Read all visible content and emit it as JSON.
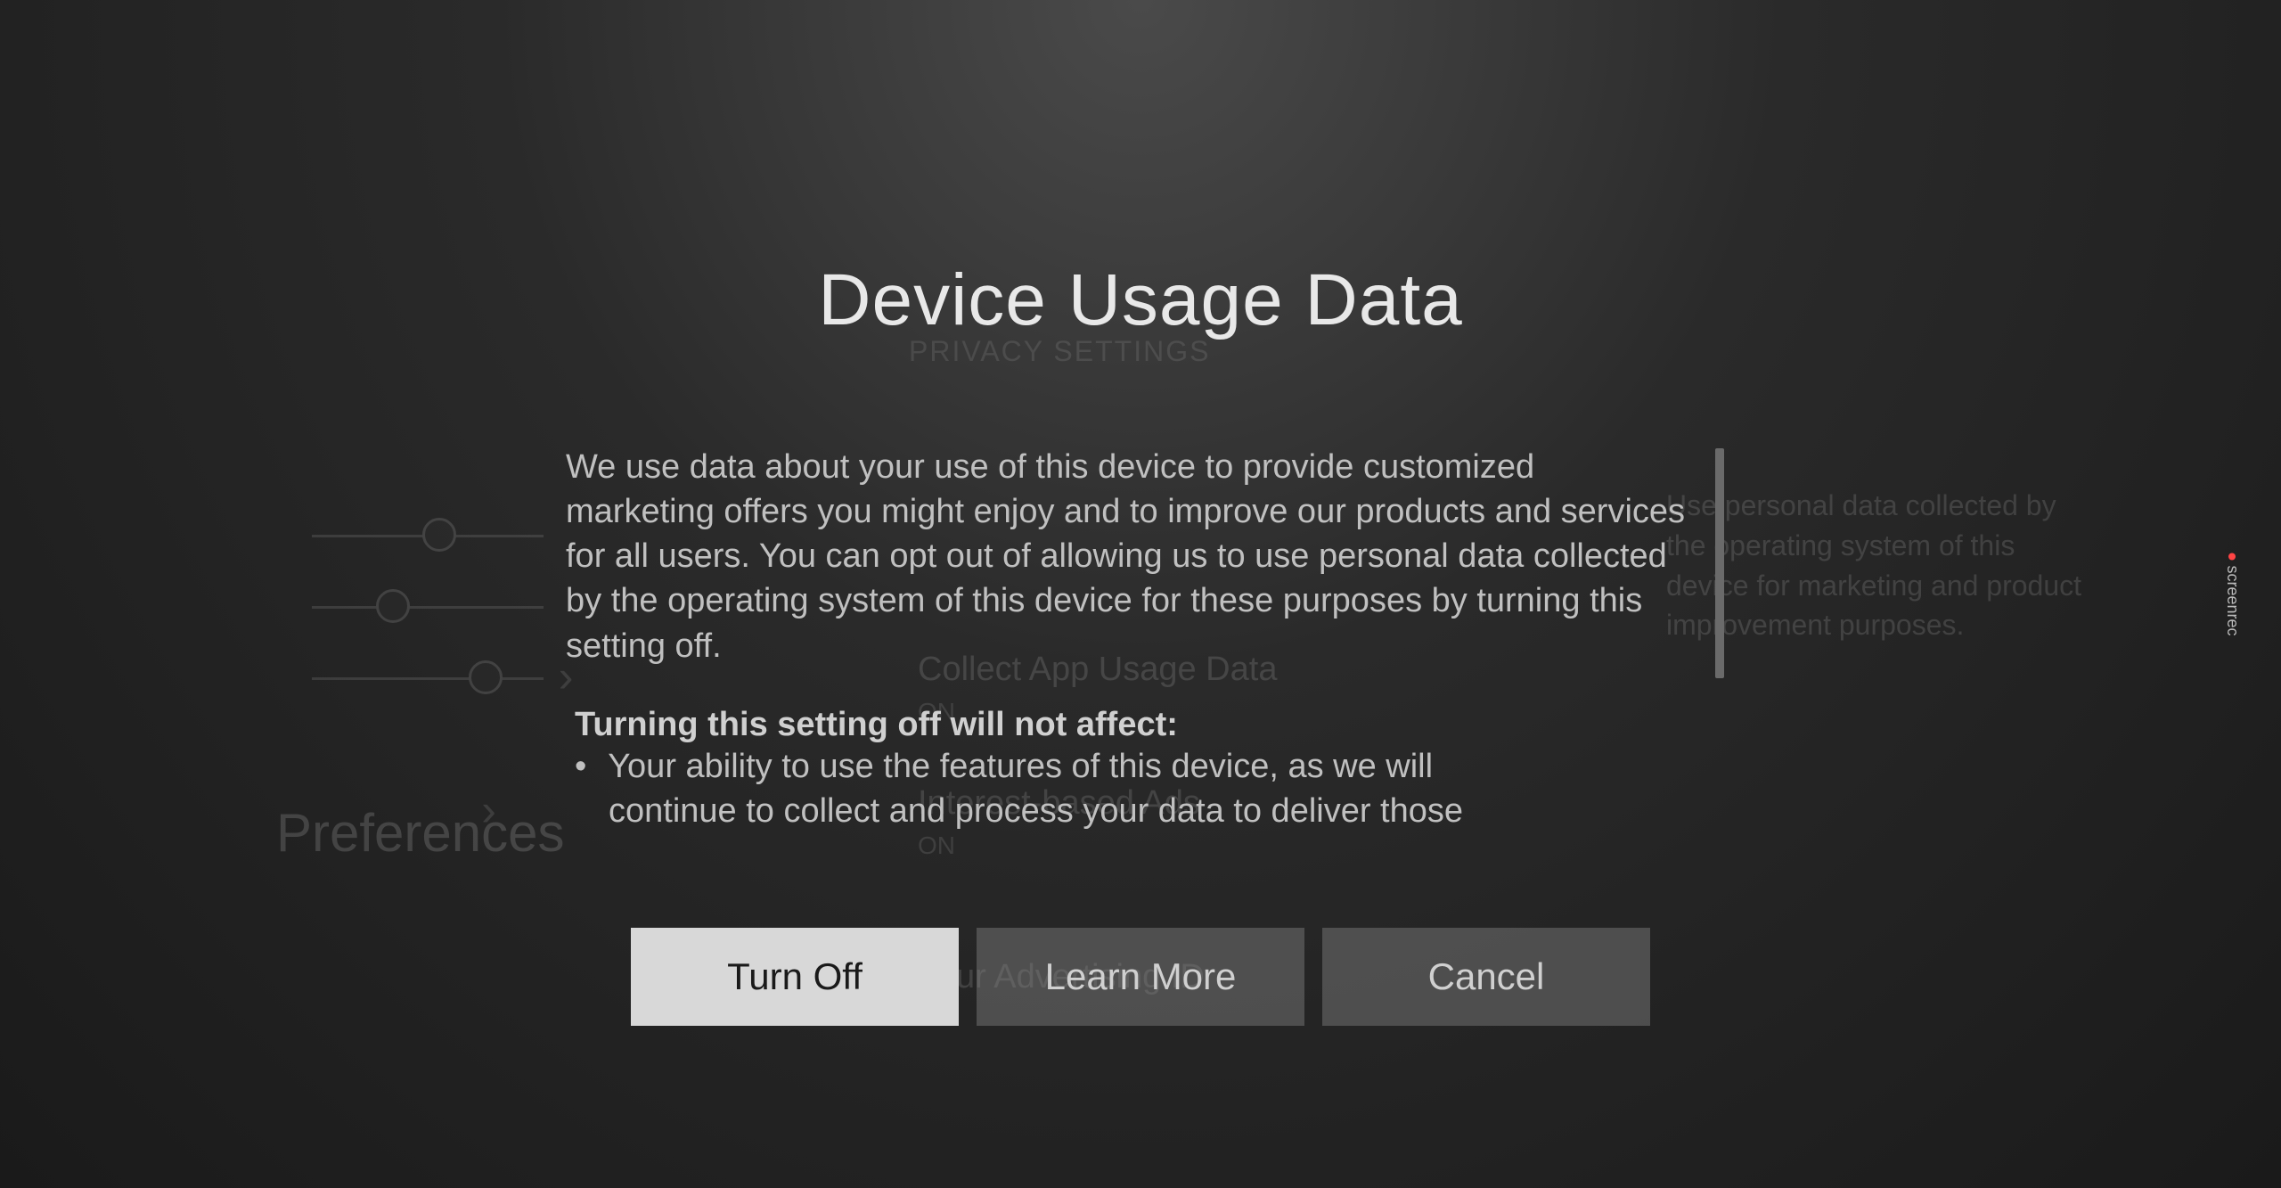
{
  "background": {
    "breadcrumb": "PRIVACY SETTINGS",
    "preferences_label": "Preferences",
    "option1": {
      "label": "Collect App Usage Data",
      "status": "ON"
    },
    "option2": {
      "label": "Interest-based Ads",
      "status": "ON"
    },
    "option3": {
      "label": "Your Advertising ID"
    },
    "side_desc": "Use personal data collected by the operating system of this device for marketing and product improvement purposes."
  },
  "dialog": {
    "title": "Device Usage Data",
    "paragraph": "We use data about your use of this device to provide customized marketing offers you might enjoy and to improve our products and services for all users.  You can opt out of allowing us to use personal data collected by the operating system of this device for these purposes by turning this setting off.",
    "subheading": "Turning this setting off will not affect:",
    "bullet1_line1": "Your ability to use the features of this device, as we will",
    "bullet1_line2": "continue to collect and process your data to deliver those",
    "buttons": {
      "turn_off": "Turn Off",
      "learn_more": "Learn More",
      "cancel": "Cancel"
    }
  },
  "watermark": "screenrec"
}
